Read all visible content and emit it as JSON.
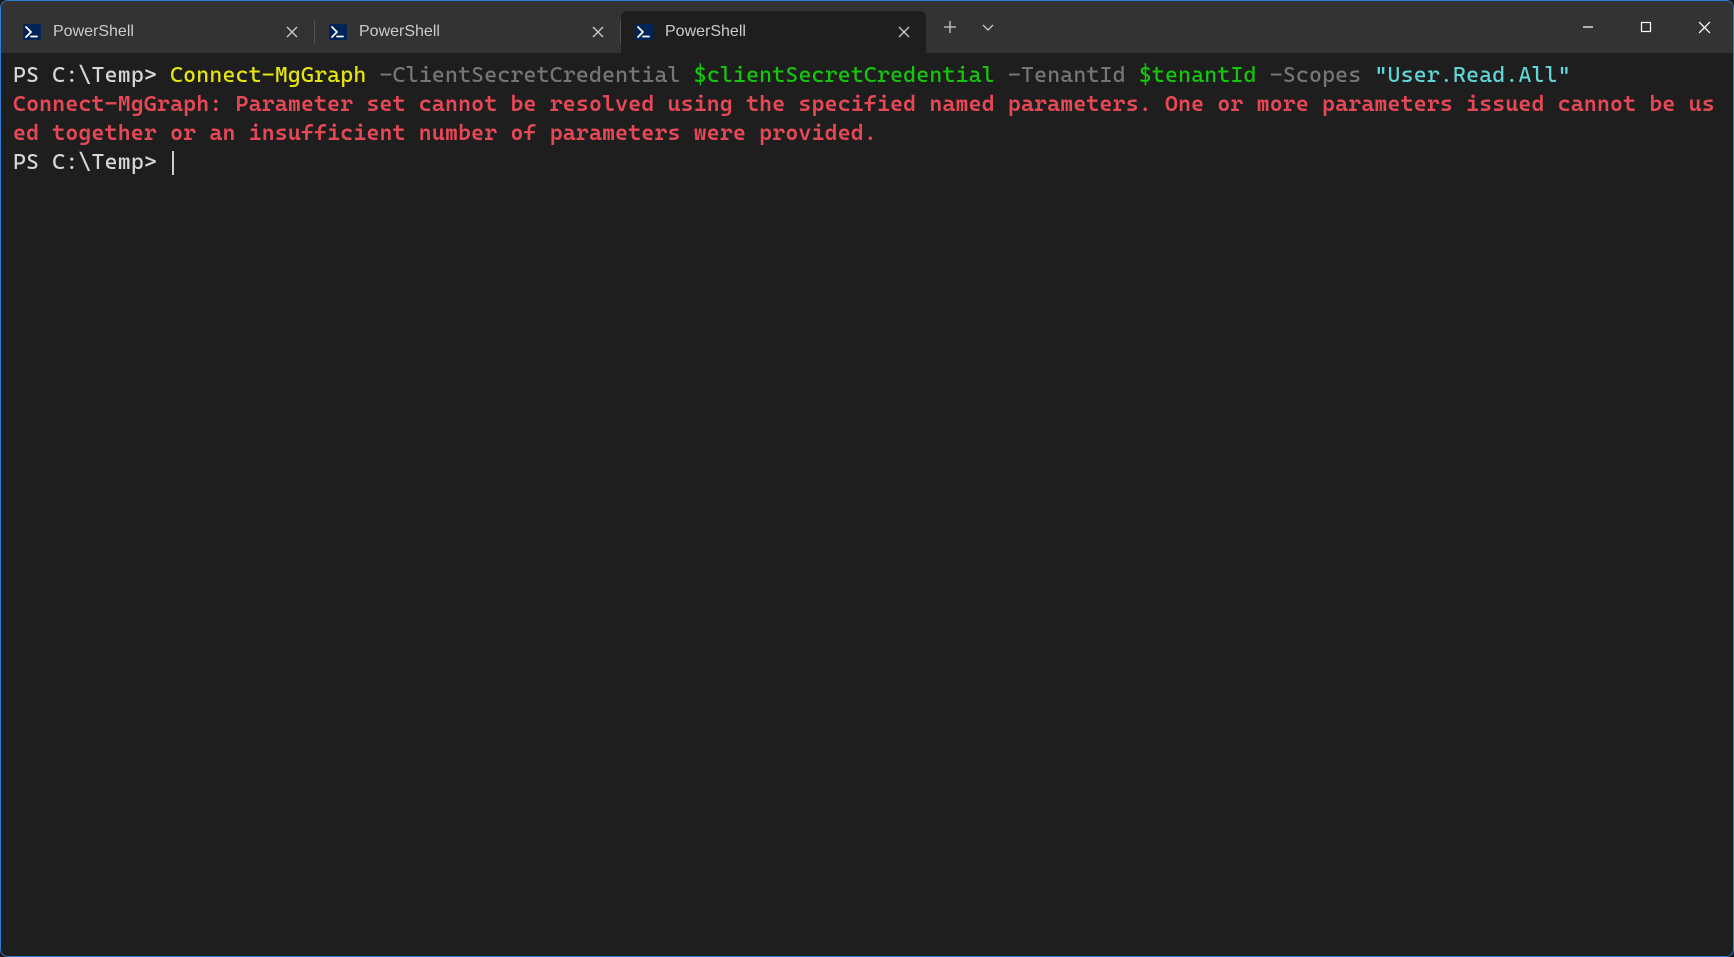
{
  "tabs": [
    {
      "label": "PowerShell",
      "active": false
    },
    {
      "label": "PowerShell",
      "active": false
    },
    {
      "label": "PowerShell",
      "active": true
    }
  ],
  "term": {
    "prompt1": "PS C:\\Temp> ",
    "cmd_cmdlet": "Connect-MgGraph ",
    "cmd_param1": "-ClientSecretCredential ",
    "cmd_var1": "$clientSecretCredential ",
    "cmd_param2": "-TenantId ",
    "cmd_var2": "$tenantId ",
    "cmd_param3": "-Scopes ",
    "cmd_string": "\"User.Read.All\"",
    "error": "Connect-MgGraph: Parameter set cannot be resolved using the specified named parameters. One or more parameters issued cannot be used together or an insufficient number of parameters were provided.",
    "prompt2": "PS C:\\Temp> "
  }
}
